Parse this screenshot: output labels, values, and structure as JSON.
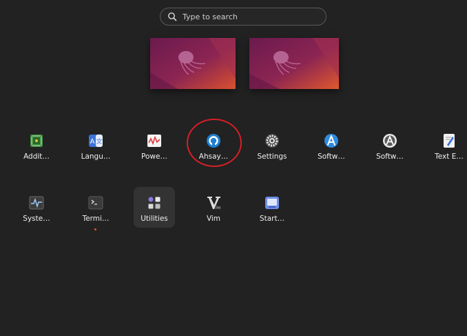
{
  "search": {
    "placeholder": "Type to search",
    "icon": "search-icon"
  },
  "workspaces": [
    {
      "name": "workspace-1"
    },
    {
      "name": "workspace-2"
    }
  ],
  "apps_row1": [
    {
      "label": "Addit…",
      "icon": "chip-icon"
    },
    {
      "label": "Langu…",
      "icon": "language-icon"
    },
    {
      "label": "Powe…",
      "icon": "power-statistics-icon"
    },
    {
      "label": "Ahsay…",
      "icon": "ahsay-icon"
    },
    {
      "label": "Settings",
      "icon": "gear-icon"
    },
    {
      "label": "Softw…",
      "icon": "software-icon"
    },
    {
      "label": "Softw…",
      "icon": "software-updater-icon"
    },
    {
      "label": "Text E…",
      "icon": "text-editor-icon"
    }
  ],
  "apps_row2": [
    {
      "label": "Syste…",
      "icon": "system-monitor-icon"
    },
    {
      "label": "Termi…",
      "icon": "terminal-icon"
    },
    {
      "label": "Utilities",
      "icon": "folder-icon"
    },
    {
      "label": "Vim",
      "icon": "vim-icon"
    },
    {
      "label": "Start…",
      "icon": "startup-disk-icon"
    }
  ],
  "colors": {
    "background": "#222222",
    "accent": "#e95420",
    "highlight": "#d81f26"
  }
}
